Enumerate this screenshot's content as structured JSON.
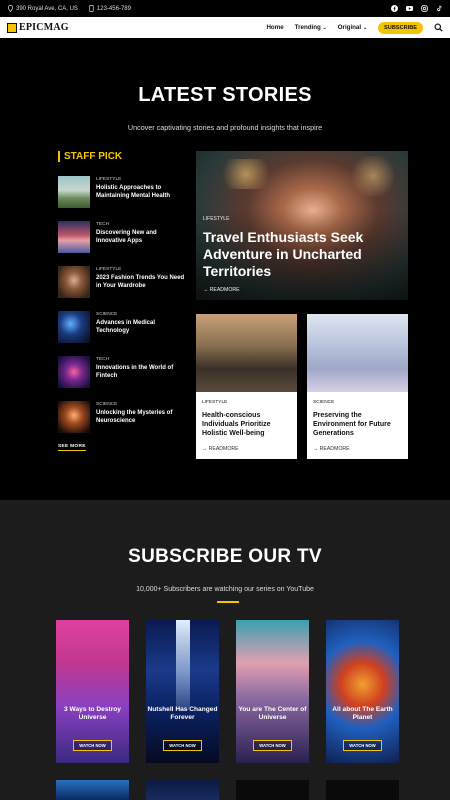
{
  "topbar": {
    "address": "390 Royal Ave, CA, US",
    "phone": "123-456-789",
    "socials": [
      "facebook-icon",
      "youtube-icon",
      "instagram-icon",
      "tiktok-icon"
    ]
  },
  "nav": {
    "logo": "EPICMAG",
    "items": [
      "Home",
      "Trending",
      "Original"
    ],
    "subscribe": "SUBSCRIBE"
  },
  "latest": {
    "title": "LATEST STORIES",
    "subtitle": "Uncover captivating stories and profound insights that inspire"
  },
  "staff_pick": {
    "heading": "STAFF PICK",
    "items": [
      {
        "cat": "LIFESTYLE",
        "title": "Holistic Approaches to Maintaining Mental Health"
      },
      {
        "cat": "TECH",
        "title": "Discovering New and Innovative Apps"
      },
      {
        "cat": "LIFESTYLE",
        "title": "2023 Fashion Trends You Need in Your Wardrobe"
      },
      {
        "cat": "SCIENCE",
        "title": "Advances in Medical Technology"
      },
      {
        "cat": "TECH",
        "title": "Innovations in the World of Fintech"
      },
      {
        "cat": "SCIENCE",
        "title": "Unlocking the Mysteries of Neuroscience"
      }
    ],
    "see_more": "SEE MORE"
  },
  "featured": {
    "cat": "LIFESTYLE",
    "title": "Travel Enthusiasts Seek Adventure in Uncharted Territories",
    "readmore": "READMORE"
  },
  "cards": [
    {
      "cat": "LIFESTYLE",
      "title": "Health-conscious Individuals Prioritize Holistic Well-being",
      "readmore": "READMORE"
    },
    {
      "cat": "SCIENCE",
      "title": "Preserving the Environment for Future Generations",
      "readmore": "READMORE"
    }
  ],
  "tv": {
    "title": "SUBSCRIBE OUR TV",
    "subtitle": "10,000+ Subscribers are watching our series on YouTube",
    "videos": [
      {
        "title": "3 Ways to Destroy Universe",
        "button": "WATCH NOW"
      },
      {
        "title": "Nutshell Has Changed Forever",
        "button": "WATCH NOW"
      },
      {
        "title": "You are The Center of Universe",
        "button": "WATCH NOW"
      },
      {
        "title": "All about The Earth Planet",
        "button": "WATCH NOW"
      }
    ]
  },
  "colors": {
    "accent": "#f5c400",
    "dark": "#000000",
    "section": "#1c1c1c"
  }
}
